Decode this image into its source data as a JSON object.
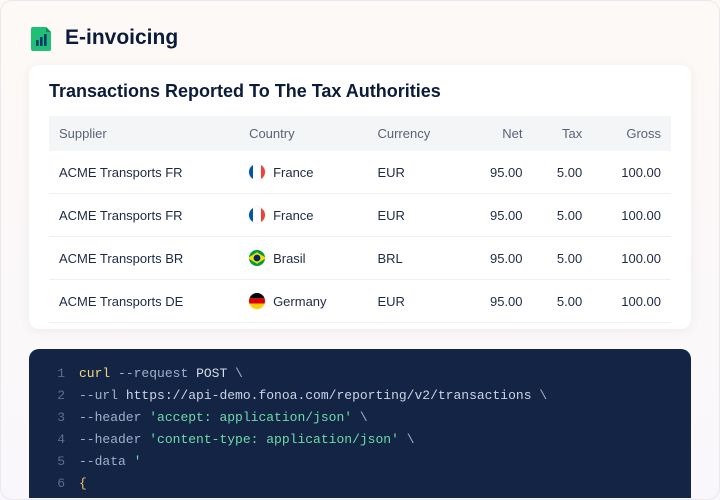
{
  "header": {
    "title": "E-invoicing",
    "logo_name": "document-chart-icon"
  },
  "card": {
    "title": "Transactions Reported To The Tax Authorities",
    "columns": {
      "supplier": "Supplier",
      "country": "Country",
      "currency": "Currency",
      "net": "Net",
      "tax": "Tax",
      "gross": "Gross"
    },
    "rows": [
      {
        "supplier": "ACME Transports FR",
        "country": "France",
        "flag": "fr",
        "currency": "EUR",
        "net": "95.00",
        "tax": "5.00",
        "gross": "100.00"
      },
      {
        "supplier": "ACME Transports FR",
        "country": "France",
        "flag": "fr",
        "currency": "EUR",
        "net": "95.00",
        "tax": "5.00",
        "gross": "100.00"
      },
      {
        "supplier": "ACME Transports BR",
        "country": "Brasil",
        "flag": "br",
        "currency": "BRL",
        "net": "95.00",
        "tax": "5.00",
        "gross": "100.00"
      },
      {
        "supplier": "ACME Transports DE",
        "country": "Germany",
        "flag": "de",
        "currency": "EUR",
        "net": "95.00",
        "tax": "5.00",
        "gross": "100.00"
      }
    ]
  },
  "code": {
    "lines": [
      {
        "ln": "1",
        "tokens": [
          [
            "cmd",
            "curl"
          ],
          [
            "sp",
            " "
          ],
          [
            "flag",
            "--request"
          ],
          [
            "sp",
            " "
          ],
          [
            "kw",
            "POST"
          ],
          [
            "sp",
            " "
          ],
          [
            "punc",
            "\\"
          ]
        ]
      },
      {
        "ln": "2",
        "tokens": [
          [
            "flag",
            "--url"
          ],
          [
            "sp",
            " "
          ],
          [
            "url",
            "https://api-demo.fonoa.com/reporting/v2/transactions"
          ],
          [
            "sp",
            " "
          ],
          [
            "punc",
            "\\"
          ]
        ]
      },
      {
        "ln": "3",
        "tokens": [
          [
            "flag",
            "--header"
          ],
          [
            "sp",
            " "
          ],
          [
            "str",
            "'accept: application/json'"
          ],
          [
            "sp",
            " "
          ],
          [
            "punc",
            "\\"
          ]
        ]
      },
      {
        "ln": "4",
        "tokens": [
          [
            "flag",
            "--header"
          ],
          [
            "sp",
            " "
          ],
          [
            "str",
            "'content-type: application/json'"
          ],
          [
            "sp",
            " "
          ],
          [
            "punc",
            "\\"
          ]
        ]
      },
      {
        "ln": "5",
        "tokens": [
          [
            "flag",
            "--data"
          ],
          [
            "sp",
            " "
          ],
          [
            "str",
            "'"
          ]
        ]
      },
      {
        "ln": "6",
        "tokens": [
          [
            "brace",
            "{"
          ]
        ]
      }
    ]
  }
}
